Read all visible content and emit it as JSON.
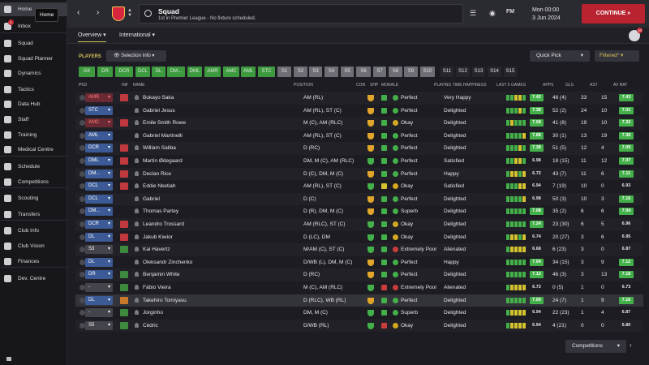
{
  "tooltip": "Home",
  "sidebar": {
    "items": [
      {
        "label": "Home",
        "icon": "home-icon"
      },
      {
        "label": "Inbox",
        "icon": "inbox-icon",
        "badge": "1"
      },
      {
        "label": "Squad",
        "icon": "squad-icon"
      },
      {
        "label": "Squad Planner",
        "icon": "planner-icon"
      },
      {
        "label": "Dynamics",
        "icon": "dynamics-icon"
      },
      {
        "label": "Tactics",
        "icon": "tactics-icon"
      },
      {
        "label": "Data Hub",
        "icon": "datahub-icon"
      },
      {
        "label": "Staff",
        "icon": "staff-icon"
      },
      {
        "label": "Training",
        "icon": "training-icon"
      },
      {
        "label": "Medical Centre",
        "icon": "medical-icon"
      },
      {
        "label": "Schedule",
        "icon": "schedule-icon"
      },
      {
        "label": "Competitions",
        "icon": "trophy-icon"
      },
      {
        "label": "Scouting",
        "icon": "scouting-icon"
      },
      {
        "label": "Transfers",
        "icon": "transfers-icon"
      },
      {
        "label": "Club Info",
        "icon": "clubinfo-icon"
      },
      {
        "label": "Club Vision",
        "icon": "vision-icon"
      },
      {
        "label": "Finances",
        "icon": "finances-icon"
      },
      {
        "label": "Dev. Centre",
        "icon": "devcentre-icon"
      }
    ]
  },
  "header": {
    "title": "Squad",
    "subtitle": "1st in Premier League - No fixture scheduled.",
    "time": "Mon 00:00",
    "date": "3 Jun 2024",
    "continue_label": "CONTINUE",
    "fm_label": "FM"
  },
  "tabs": {
    "overview": "Overview",
    "international": "International"
  },
  "avatar_badge": "10",
  "filters": {
    "players_label": "PLAYERS",
    "selection_info": "Selection Info",
    "quick_pick": "Quick Pick",
    "filtered": "Filtered*",
    "positions": [
      {
        "label": "GK",
        "state": "green"
      },
      {
        "label": "DR",
        "state": "green"
      },
      {
        "label": "DCR",
        "state": "green"
      },
      {
        "label": "DCL",
        "state": "green"
      },
      {
        "label": "DL",
        "state": "green"
      },
      {
        "label": "DM...",
        "state": "green"
      },
      {
        "label": "DML",
        "state": "green"
      },
      {
        "label": "AMR",
        "state": "green"
      },
      {
        "label": "AMC",
        "state": "green"
      },
      {
        "label": "AML",
        "state": "green"
      },
      {
        "label": "STC",
        "state": "green"
      },
      {
        "label": "S1",
        "state": "grey"
      },
      {
        "label": "S2",
        "state": "grey"
      },
      {
        "label": "S3",
        "state": "grey"
      },
      {
        "label": "S4",
        "state": "grey"
      },
      {
        "label": "S5",
        "state": "grey"
      },
      {
        "label": "S6",
        "state": "grey"
      },
      {
        "label": "S7",
        "state": "grey"
      },
      {
        "label": "S8",
        "state": "grey"
      },
      {
        "label": "S9",
        "state": "grey"
      },
      {
        "label": "S10",
        "state": "grey"
      },
      {
        "label": "S11",
        "state": "dark"
      },
      {
        "label": "S12",
        "state": "dark"
      },
      {
        "label": "S13",
        "state": "dark"
      },
      {
        "label": "S14",
        "state": "dark"
      },
      {
        "label": "S15",
        "state": "dark"
      }
    ]
  },
  "columns": [
    "PKD",
    "INF",
    "NAME",
    "POSITION",
    "CON",
    "SHP",
    "MORALE",
    "PLAYING TIME HAPPINESS",
    "LAST 5 GAMES",
    "APPS",
    "GLS",
    "AST",
    "AV RAT"
  ],
  "players": [
    {
      "pkd": "AMR",
      "pkd_style": "red",
      "inf": "red",
      "name": "Bukayo Saka",
      "position": "AM (RL)",
      "con": "orange",
      "shp": "green",
      "morale": "Perfect",
      "morale_color": "#43b049",
      "pth": "Very Happy",
      "form": "ggyyg",
      "last5": "7.42",
      "apps": "46 (4)",
      "gls": "33",
      "ast": "15",
      "avrat": "7.43",
      "avrat_color": "#43b049"
    },
    {
      "pkd": "STC",
      "pkd_style": "blue",
      "inf": "none",
      "name": "Gabriel Jesus",
      "position": "AM (RL), ST (C)",
      "con": "orange",
      "shp": "green",
      "morale": "Perfect",
      "morale_color": "#43b049",
      "pth": "Delighted",
      "form": "gggyg",
      "last5": "7.38",
      "apps": "52 (2)",
      "gls": "24",
      "ast": "10",
      "avrat": "7.01",
      "avrat_color": "#43b049"
    },
    {
      "pkd": "AMC",
      "pkd_style": "red",
      "inf": "red",
      "name": "Emile Smith Rowe",
      "position": "M (C), AM (RLC)",
      "con": "orange",
      "shp": "green",
      "morale": "Okay",
      "morale_color": "#d4a81e",
      "pth": "Delighted",
      "form": "gyggg",
      "last5": "7.08",
      "apps": "41 (8)",
      "gls": "19",
      "ast": "10",
      "avrat": "7.33",
      "avrat_color": "#43b049"
    },
    {
      "pkd": "AML",
      "pkd_style": "blue",
      "inf": "none",
      "name": "Gabriel Martinelli",
      "position": "AM (RL), ST (C)",
      "con": "orange",
      "shp": "green",
      "morale": "Perfect",
      "morale_color": "#43b049",
      "pth": "Delighted",
      "form": "ggggy",
      "last5": "7.88",
      "apps": "30 (1)",
      "gls": "13",
      "ast": "19",
      "avrat": "7.38",
      "avrat_color": "#43b049"
    },
    {
      "pkd": "DCR",
      "pkd_style": "blue",
      "inf": "red",
      "name": "William Saliba",
      "position": "D (RC)",
      "con": "orange",
      "shp": "green",
      "morale": "Perfect",
      "morale_color": "#43b049",
      "pth": "Delighted",
      "form": "gggyg",
      "last5": "7.38",
      "apps": "51 (5)",
      "gls": "12",
      "ast": "4",
      "avrat": "7.09",
      "avrat_color": "#43b049"
    },
    {
      "pkd": "DML",
      "pkd_style": "blue",
      "inf": "red",
      "name": "Martin Ødegaard",
      "position": "DM, M (C), AM (RLC)",
      "con": "green",
      "shp": "green",
      "morale": "Perfect",
      "morale_color": "#43b049",
      "pth": "Satisfied",
      "form": "ggyyg",
      "last5": "6.98",
      "apps": "18 (15)",
      "gls": "11",
      "ast": "12",
      "avrat": "7.07",
      "avrat_color": "#43b049"
    },
    {
      "pkd": "DM...",
      "pkd_style": "blue",
      "inf": "red",
      "name": "Declan Rice",
      "position": "D (C), DM, M (C)",
      "con": "orange",
      "shp": "green",
      "morale": "Perfect",
      "morale_color": "#43b049",
      "pth": "Happy",
      "form": "gyygy",
      "last5": "6.72",
      "apps": "43 (7)",
      "gls": "11",
      "ast": "6",
      "avrat": "7.11",
      "avrat_color": "#43b049"
    },
    {
      "pkd": "DCL",
      "pkd_style": "blue",
      "inf": "red",
      "name": "Eddie Nketiah",
      "position": "AM (RL), ST (C)",
      "con": "green",
      "shp": "yellow",
      "morale": "Okay",
      "morale_color": "#d4a81e",
      "pth": "Satisfied",
      "form": "gggyy",
      "last5": "6.94",
      "apps": "7 (19)",
      "gls": "10",
      "ast": "0",
      "avrat": "6.93",
      "avrat_color": "none"
    },
    {
      "pkd": "DCL",
      "pkd_style": "blue",
      "inf": "none",
      "name": "Gabriel",
      "position": "D (C)",
      "con": "orange",
      "shp": "green",
      "morale": "Perfect",
      "morale_color": "#43b049",
      "pth": "Delighted",
      "form": "ggggy",
      "last5": "6.98",
      "apps": "50 (3)",
      "gls": "10",
      "ast": "3",
      "avrat": "7.16",
      "avrat_color": "#43b049"
    },
    {
      "pkd": "DM...",
      "pkd_style": "blue",
      "inf": "none",
      "name": "Thomas Partey",
      "position": "D (R), DM, M (C)",
      "con": "orange",
      "shp": "green",
      "morale": "Superb",
      "morale_color": "#43b049",
      "pth": "Delighted",
      "form": "ggggg",
      "last5": "7.08",
      "apps": "35 (2)",
      "gls": "6",
      "ast": "6",
      "avrat": "7.04",
      "avrat_color": "#43b049"
    },
    {
      "pkd": "DCR",
      "pkd_style": "blue",
      "inf": "red",
      "name": "Leandro Trossard",
      "position": "AM (RLC), ST (C)",
      "con": "green",
      "shp": "green",
      "morale": "Okay",
      "morale_color": "#d4a81e",
      "pth": "Delighted",
      "form": "ggggg",
      "last5": "7.24",
      "apps": "23 (30)",
      "gls": "6",
      "ast": "5",
      "avrat": "6.96",
      "avrat_color": "none"
    },
    {
      "pkd": "DL",
      "pkd_style": "blue",
      "inf": "red",
      "name": "Jakub Kiwior",
      "position": "D (LC), DM",
      "con": "green",
      "shp": "green",
      "morale": "Okay",
      "morale_color": "#d4a81e",
      "pth": "Delighted",
      "form": "gyygy",
      "last5": "6.74",
      "apps": "20 (27)",
      "gls": "3",
      "ast": "6",
      "avrat": "6.95",
      "avrat_color": "none"
    },
    {
      "pkd": "S3",
      "pkd_style": "grey",
      "inf": "green",
      "name": "Kai Havertz",
      "position": "M/AM (C), ST (C)",
      "con": "green",
      "shp": "green",
      "morale": "Extremely Poor",
      "morale_color": "#c93c3c",
      "pth": "Alienated",
      "form": "gyyyy",
      "last5": "6.68",
      "apps": "6 (23)",
      "gls": "3",
      "ast": "0",
      "avrat": "6.87",
      "avrat_color": "none"
    },
    {
      "pkd": "DL",
      "pkd_style": "blue",
      "inf": "none",
      "name": "Oleksandr Zinchenko",
      "position": "D/WB (L), DM, M (C)",
      "con": "orange",
      "shp": "green",
      "morale": "Perfect",
      "morale_color": "#43b049",
      "pth": "Happy",
      "form": "ggggg",
      "last5": "7.04",
      "apps": "34 (15)",
      "gls": "3",
      "ast": "9",
      "avrat": "7.12",
      "avrat_color": "#43b049"
    },
    {
      "pkd": "DR",
      "pkd_style": "blue",
      "inf": "green",
      "name": "Benjamin White",
      "position": "D (RC)",
      "con": "orange",
      "shp": "green",
      "morale": "Perfect",
      "morale_color": "#43b049",
      "pth": "Delighted",
      "form": "ggggg",
      "last5": "7.12",
      "apps": "46 (3)",
      "gls": "3",
      "ast": "13",
      "avrat": "7.18",
      "avrat_color": "#43b049"
    },
    {
      "pkd": "-",
      "pkd_style": "grey",
      "inf": "green",
      "name": "Fábio Vieira",
      "position": "M (C), AM (RLC)",
      "con": "green",
      "shp": "red",
      "morale": "Extremely Poor",
      "morale_color": "#c93c3c",
      "pth": "Alienated",
      "form": "gyyyy",
      "last5": "6.73",
      "apps": "0 (5)",
      "gls": "1",
      "ast": "0",
      "avrat": "6.73",
      "avrat_color": "none"
    },
    {
      "pkd": "DL",
      "pkd_style": "blue",
      "inf": "orange",
      "name": "Takehiro Tomiyasu",
      "position": "D (RLC), WB (RL)",
      "con": "orange",
      "shp": "green",
      "morale": "Perfect",
      "morale_color": "#43b049",
      "pth": "Delighted",
      "form": "ggggg",
      "last5": "7.00",
      "apps": "24 (7)",
      "gls": "1",
      "ast": "9",
      "avrat": "7.16",
      "avrat_color": "#43b049"
    },
    {
      "pkd": "-",
      "pkd_style": "grey",
      "inf": "green",
      "name": "Jorginho",
      "position": "DM, M (C)",
      "con": "green",
      "shp": "green",
      "morale": "Superb",
      "morale_color": "#43b049",
      "pth": "Delighted",
      "form": "gyyyy",
      "last5": "6.94",
      "apps": "22 (23)",
      "gls": "1",
      "ast": "4",
      "avrat": "6.87",
      "avrat_color": "none"
    },
    {
      "pkd": "S5",
      "pkd_style": "grey",
      "inf": "green",
      "name": "Cédric",
      "position": "D/WB (RL)",
      "con": "green",
      "shp": "red",
      "morale": "Okay",
      "morale_color": "#d4a81e",
      "pth": "Delighted",
      "form": "gyyyy",
      "last5": "6.94",
      "apps": "4 (21)",
      "gls": "0",
      "ast": "0",
      "avrat": "6.80",
      "avrat_color": "none"
    }
  ],
  "competitions_label": "Competitions",
  "colors": {
    "accent_red": "#b9232f",
    "positive_green": "#43b049",
    "gold": "#d6c25a"
  }
}
